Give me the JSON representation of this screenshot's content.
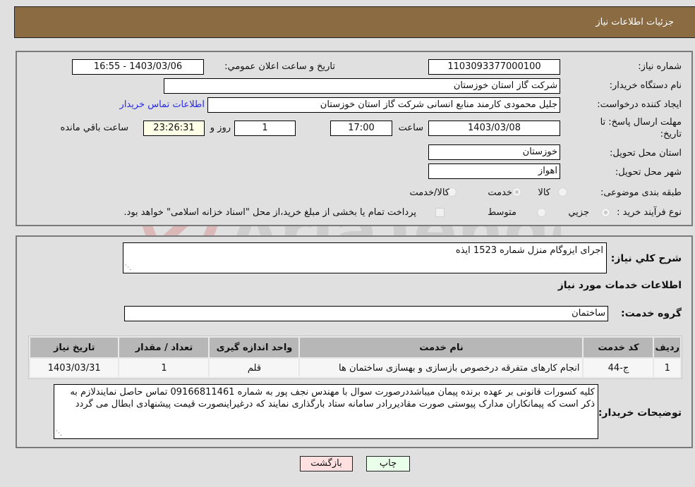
{
  "header": {
    "title": "جزئیات اطلاعات نیاز"
  },
  "form": {
    "need_number": {
      "label": "شماره نیاز:",
      "value": "1103093377000100"
    },
    "announce_datetime": {
      "label": "تاریخ و ساعت اعلان عمومي:",
      "value": "1403/03/06 - 16:55"
    },
    "buyer_org": {
      "label": "نام دستگاه خریدار:",
      "value": "شرکت گاز استان خوزستان"
    },
    "requester": {
      "label": "ایجاد کننده درخواست:",
      "value": "جلیل محمودی کارمند منابع انسانی شرکت گاز استان خوزستان"
    },
    "buyer_contact_link": "اطلاعات تماس خریدار",
    "deadline": {
      "label_line1": "مهلت ارسال پاسخ: تا",
      "label_line2": "تاریخ:",
      "date": "1403/03/08",
      "time_label": "ساعت",
      "time": "17:00",
      "days": "1",
      "days_label": "روز و",
      "remaining": "23:26:31",
      "remaining_label": "ساعت باقي مانده"
    },
    "delivery_province": {
      "label": "استان محل تحویل:",
      "value": "خوزستان"
    },
    "delivery_city": {
      "label": "شهر محل تحویل:",
      "value": "اهواز"
    },
    "category": {
      "label": "طبقه بندی موضوعی:",
      "options": [
        "کالا",
        "خدمت",
        "کالا/خدمت"
      ],
      "selected": "خدمت"
    },
    "purchase_process": {
      "label": "نوع فرآیند خرید :",
      "options": [
        "جزيي",
        "متوسط"
      ],
      "selected": "جزيي",
      "treasury_note": "پرداخت تمام یا بخشی از مبلغ خرید،از محل \"اسناد خزانه اسلامی\" خواهد بود."
    }
  },
  "details": {
    "general_desc_label": "شرح کلي نیاز:",
    "general_desc_value": "اجرای ایزوگام منزل شماره 1523 ایذه",
    "services_heading": "اطلاعات خدمات مورد نیاز",
    "service_group_label": "گروه خدمت:",
    "service_group_value": "ساختمان",
    "table": {
      "headers": [
        "ردیف",
        "کد خدمت",
        "نام خدمت",
        "واحد اندازه گیری",
        "تعداد / مقدار",
        "تاریخ نیاز"
      ],
      "rows": [
        [
          "1",
          "ج-44",
          "انجام کارهای متفرقه درخصوص بازسازی و بهسازی ساختمان ها",
          "قلم",
          "1",
          "1403/03/31"
        ]
      ]
    },
    "buyer_notes_label": "توضیحات خریدار:",
    "buyer_notes_value": "کلیه کسورات قانونی بر عهده برنده پیمان میباشددرصورت سوال با مهندس نجف پور به شماره 09166811461 تماس حاصل نمایندلازم به ذکر است که پیمانکاران مدارک پیوستی صورت مقادیررادر سامانه ستاد بارگذاری نمایند که درغیراینصورت قیمت پیشنهادی ابطال می گردد"
  },
  "buttons": {
    "print": "چاپ",
    "back": "بازگشت"
  },
  "colors": {
    "header_bg": "#8b6b42",
    "print_bg": "#eaffea",
    "back_bg": "#ffe0e0",
    "link": "#2a2ae0"
  },
  "watermark": {
    "text": "AriaTender.neT"
  }
}
